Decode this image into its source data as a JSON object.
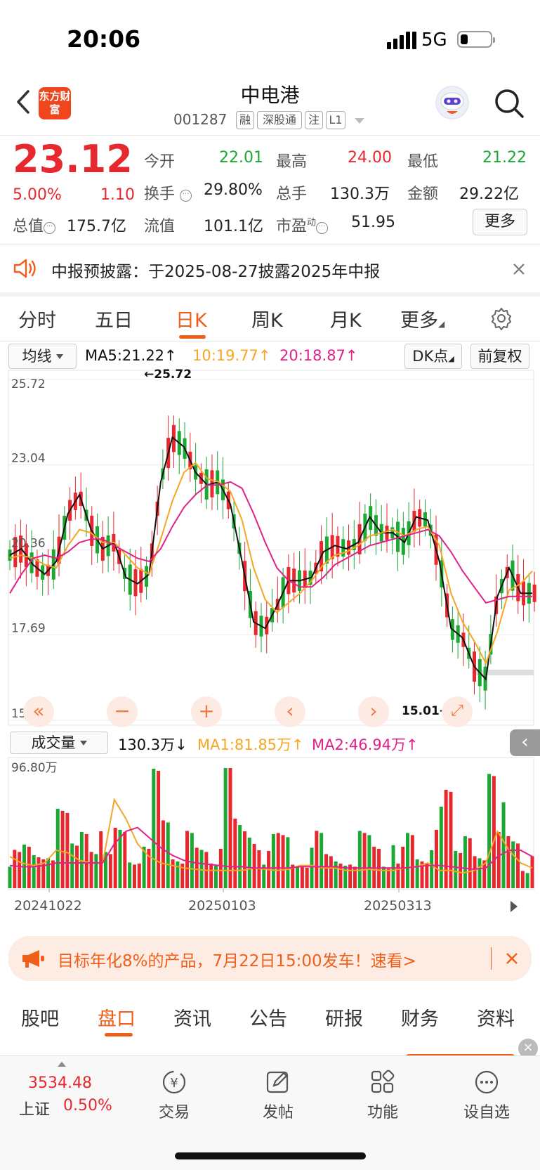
{
  "status_bar": {
    "time": "20:06",
    "network": "5G"
  },
  "header": {
    "name": "中电港",
    "code": "001287",
    "tags": [
      "融",
      "深股通",
      "注",
      "L1"
    ],
    "logo": "东方财富"
  },
  "quote": {
    "price": "23.12",
    "pct": "5.00%",
    "chg": "1.10",
    "open_label": "今开",
    "open": "22.01",
    "high_label": "最高",
    "high": "24.00",
    "low_label": "最低",
    "low": "21.22",
    "turnover_label": "换手",
    "turnover": "29.80%",
    "volume_label": "总手",
    "volume": "130.3万",
    "amount_label": "金额",
    "amount": "29.22亿",
    "mktcap_label": "总值",
    "mktcap": "175.7亿",
    "float_label": "流值",
    "float": "101.1亿",
    "pe_label": "市盈",
    "pe_sup": "动",
    "pe": "51.95",
    "more": "更多"
  },
  "notice": {
    "text": "中报预披露：于2025-08-27披露2025年中报"
  },
  "chart_tabs": [
    "分时",
    "五日",
    "日K",
    "周K",
    "月K",
    "更多"
  ],
  "active_tab": "日K",
  "ma_bar": {
    "select": "均线",
    "ma5": "MA5:21.22↑",
    "ma10": "10:19.77↑",
    "ma20": "20:18.87↑",
    "dk": "DK点",
    "fq": "前复权"
  },
  "vol_bar": {
    "select": "成交量",
    "vol": "130.3万↓",
    "ma1": "MA1:81.85万↑",
    "ma2": "MA2:46.94万↑"
  },
  "colors": {
    "up": "#e8282f",
    "down": "#1ba833",
    "ma5": "#111111",
    "ma10": "#f5a623",
    "ma20": "#e0218a",
    "accent": "#ef5f19"
  },
  "chart_data": {
    "type": "line",
    "yticks": [
      "25.72",
      "23.04",
      "20.36",
      "17.69",
      "15.01"
    ],
    "ylim": [
      15.01,
      25.72
    ],
    "x_dates": [
      "20241022",
      "20250103",
      "20250313"
    ],
    "annotations": [
      "←25.72",
      "15.01→"
    ],
    "vol_ymax_label": "96.80万",
    "series": [
      {
        "name": "MA5",
        "values": [
          20.2,
          20.4,
          19.9,
          19.6,
          20.0,
          21.5,
          22.1,
          21.0,
          20.4,
          20.6,
          19.5,
          19.3,
          19.6,
          22.5,
          23.9,
          23.6,
          22.8,
          22.4,
          22.5,
          21.8,
          20.0,
          18.1,
          17.9,
          18.6,
          19.4,
          19.4,
          19.5,
          20.3,
          20.5,
          20.4,
          20.6,
          21.4,
          20.9,
          20.9,
          20.6,
          21.4,
          21.3,
          20.0,
          17.9,
          17.6,
          16.7,
          16.3,
          18.9,
          19.8,
          19.0,
          19.0
        ]
      },
      {
        "name": "10",
        "values": [
          20.1,
          20.2,
          20.1,
          19.9,
          19.8,
          20.5,
          21.0,
          20.9,
          20.6,
          20.6,
          20.2,
          19.8,
          19.6,
          20.7,
          21.9,
          22.8,
          23.1,
          22.6,
          22.5,
          22.2,
          21.3,
          19.8,
          18.8,
          18.4,
          18.7,
          19.0,
          19.4,
          19.9,
          20.2,
          20.3,
          20.5,
          20.8,
          20.9,
          21.0,
          20.8,
          21.0,
          21.1,
          20.5,
          19.0,
          18.1,
          17.5,
          16.8,
          17.8,
          19.1,
          19.3,
          19.7
        ]
      },
      {
        "name": "20",
        "values": [
          19.0,
          19.6,
          20.1,
          20.2,
          20.1,
          20.3,
          20.6,
          20.7,
          20.7,
          20.5,
          20.3,
          20.1,
          20.0,
          20.4,
          21.1,
          21.7,
          22.1,
          22.4,
          22.4,
          22.5,
          22.3,
          21.5,
          20.6,
          19.8,
          19.4,
          19.2,
          19.2,
          19.5,
          19.9,
          20.1,
          20.3,
          20.5,
          20.6,
          20.7,
          20.8,
          20.9,
          21.0,
          20.8,
          20.3,
          19.7,
          19.2,
          18.7,
          18.8,
          18.9,
          18.9,
          18.9
        ]
      }
    ]
  },
  "promo": {
    "text": "目标年化8%的产品，7月22日15:00发车！速看>"
  },
  "bottom_tabs": [
    "股吧",
    "盘口",
    "资讯",
    "公告",
    "研报",
    "财务",
    "资料"
  ],
  "active_bottom_tab": "盘口",
  "bottom_bar": {
    "index_value": "3534.48",
    "index_name": "上证",
    "index_pct": "0.50%",
    "items": [
      "交易",
      "发帖",
      "功能",
      "设自选"
    ]
  }
}
